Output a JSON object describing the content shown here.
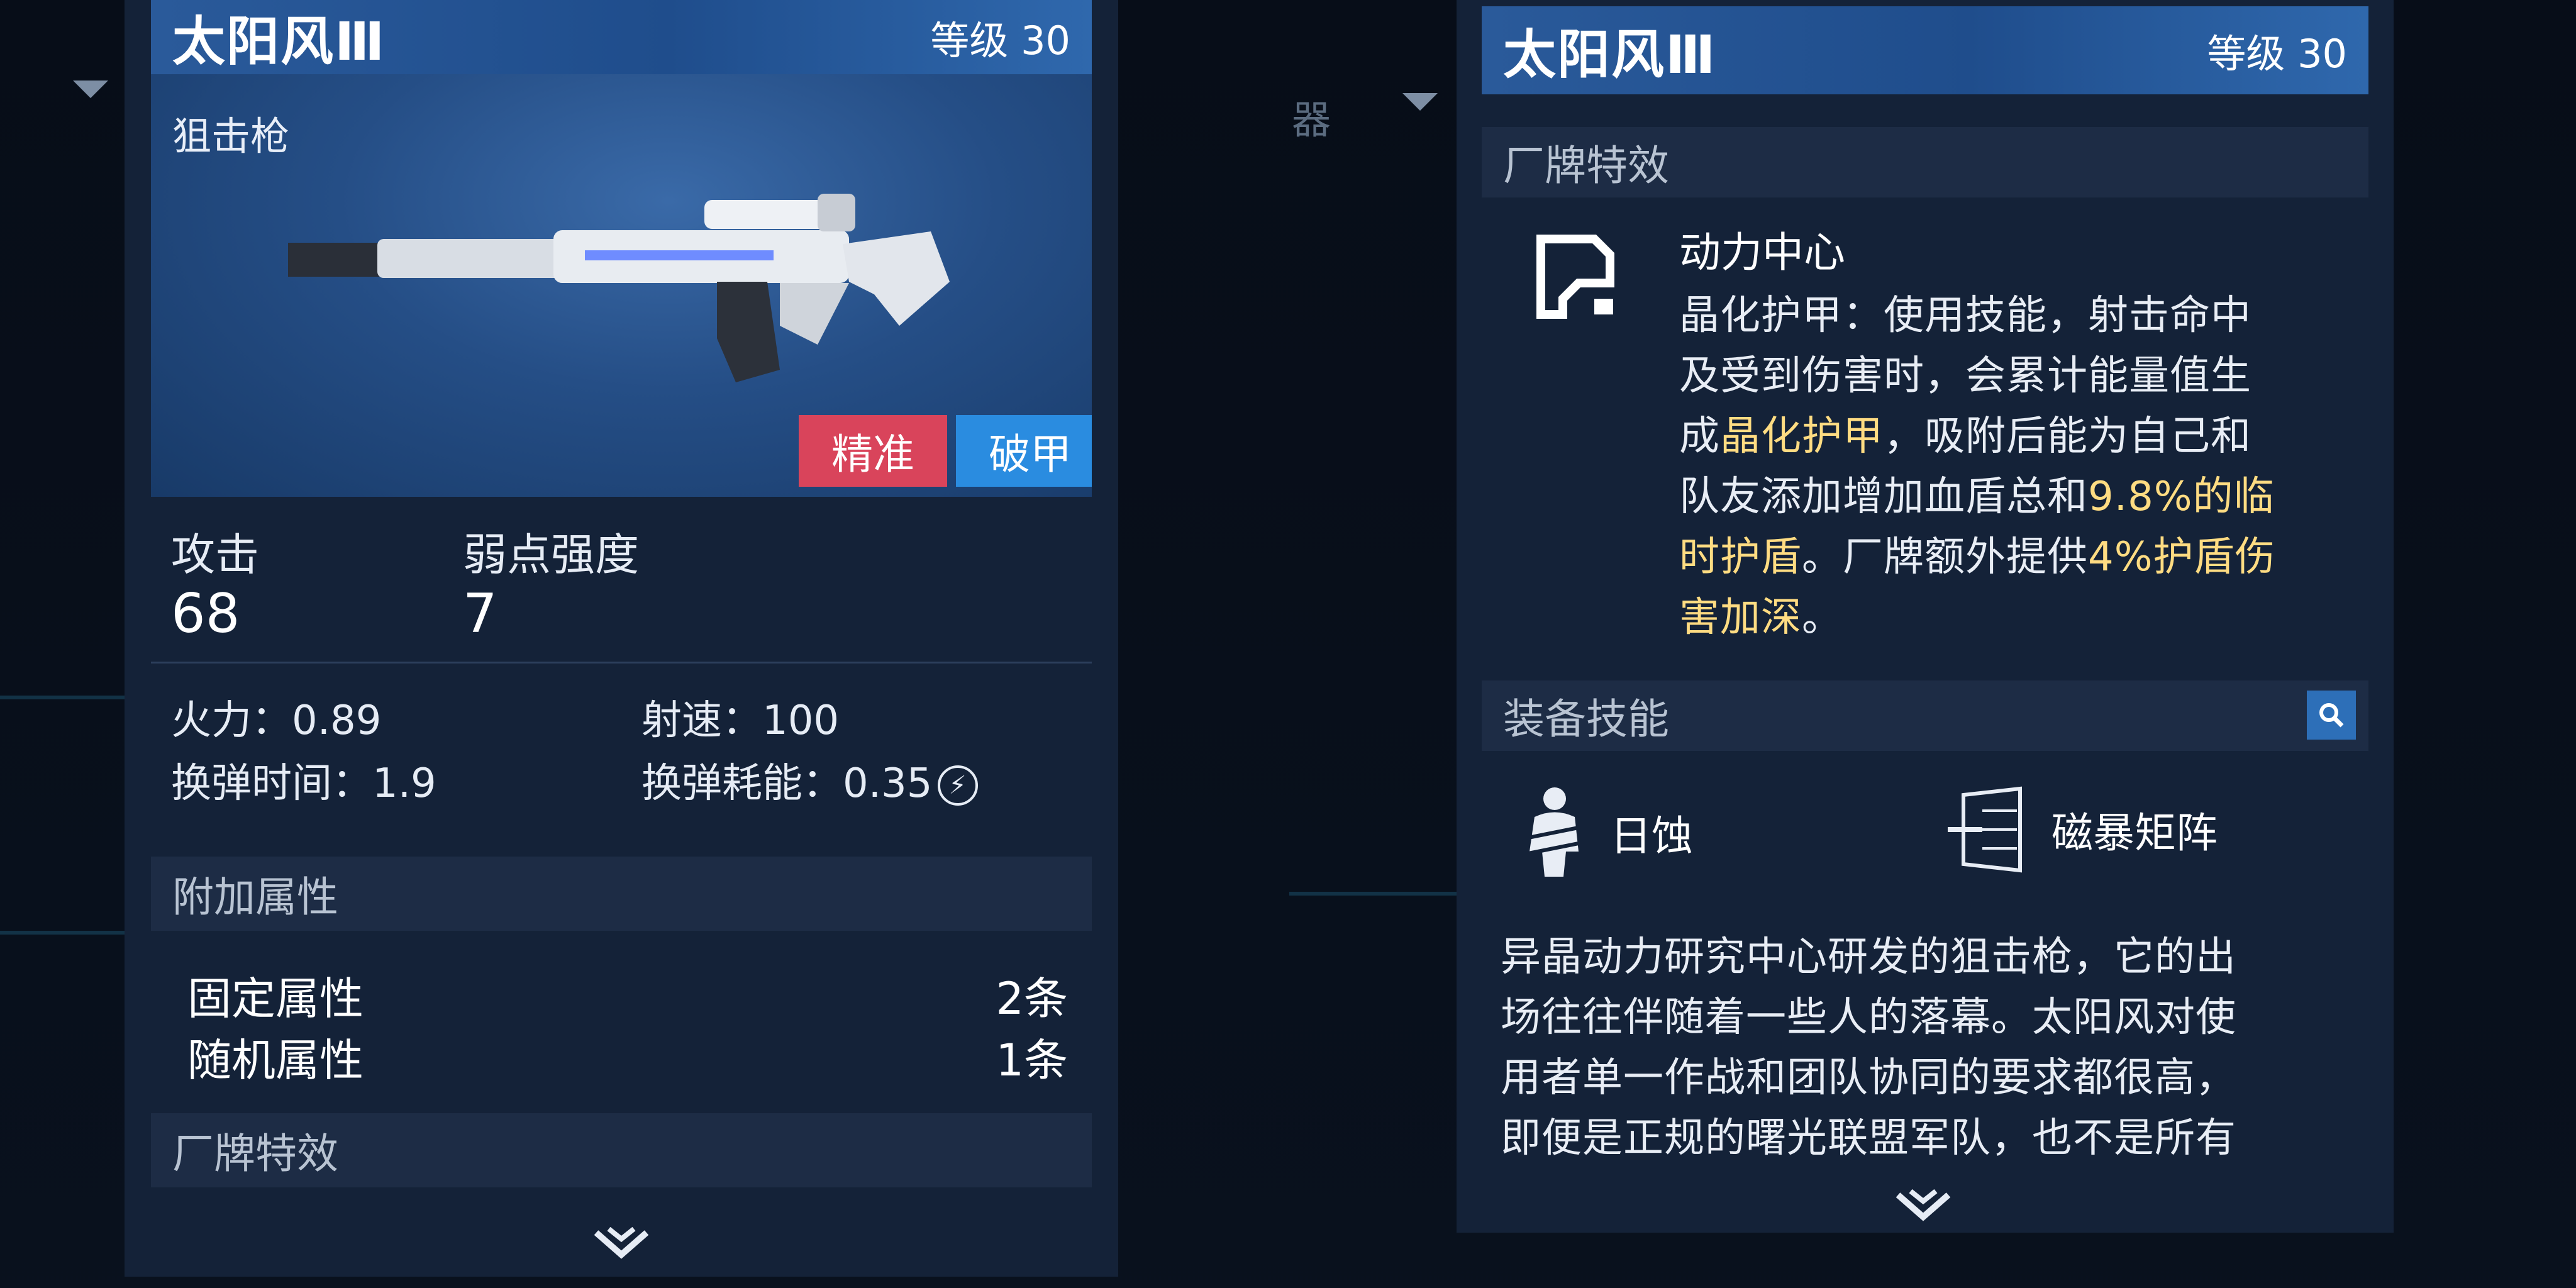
{
  "background": {
    "left_text": "器"
  },
  "left_panel": {
    "title": "太阳风Ⅲ",
    "level": "等级 30",
    "weapon_type": "狙击枪",
    "tags": {
      "tag1": "精准",
      "tag2": "破甲"
    },
    "attack_label": "攻击",
    "attack_value": "68",
    "weak_label": "弱点强度",
    "weak_value": "7",
    "firepower": "火力：0.89",
    "fire_rate": "射速：100",
    "reload_time": "换弹时间：1.9",
    "reload_cost": "换弹耗能：0.35",
    "extra_attr_header": "附加属性",
    "fixed_attr_label": "固定属性",
    "fixed_attr_value": "2条",
    "random_attr_label": "随机属性",
    "random_attr_value": "1条",
    "brand_header": "厂牌特效"
  },
  "right_panel": {
    "title": "太阳风Ⅲ",
    "level": "等级 30",
    "brand_header": "厂牌特效",
    "brand_name": "动力中心",
    "effect_line1": "晶化护甲：使用技能，射击命中",
    "effect_line2": "及受到伤害时，会累计能量值生",
    "effect_line3_a": "成",
    "effect_line3_hl": "晶化护甲",
    "effect_line3_b": "，吸附后能为自己和",
    "effect_line4_a": "队友添加增加血盾总和",
    "effect_line4_hl": "9.8%的临",
    "effect_line5_hl": "时护盾",
    "effect_line5_b": "。厂牌额外提供",
    "effect_line5_hl2": "4%护盾伤",
    "effect_line6_hl": "害加深",
    "effect_line6_b": "。",
    "skills_header": "装备技能",
    "skill1": "日蚀",
    "skill2": "磁暴矩阵",
    "desc_line1": "异晶动力研究中心研发的狙击枪，它的出",
    "desc_line2": "场往往伴随着一些人的落幕。太阳风对使",
    "desc_line3": "用者单一作战和团队协同的要求都很高，",
    "desc_line4": "即便是正规的曙光联盟军队，也不是所有"
  },
  "colors": {
    "panel_bg": "#142238",
    "title_bar": "#2a5a9a",
    "tag_red": "#d9445b",
    "tag_blue": "#2a8ce0",
    "highlight": "#ffdc82"
  },
  "icons": {
    "brand_icon": "power-center-logo-icon",
    "search": "search-icon",
    "skill1": "eclipse-figure-icon",
    "skill2": "magnetic-matrix-icon",
    "scroll_down": "chevron-down-icon",
    "reload_cost": "lightning-bolt-icon"
  }
}
